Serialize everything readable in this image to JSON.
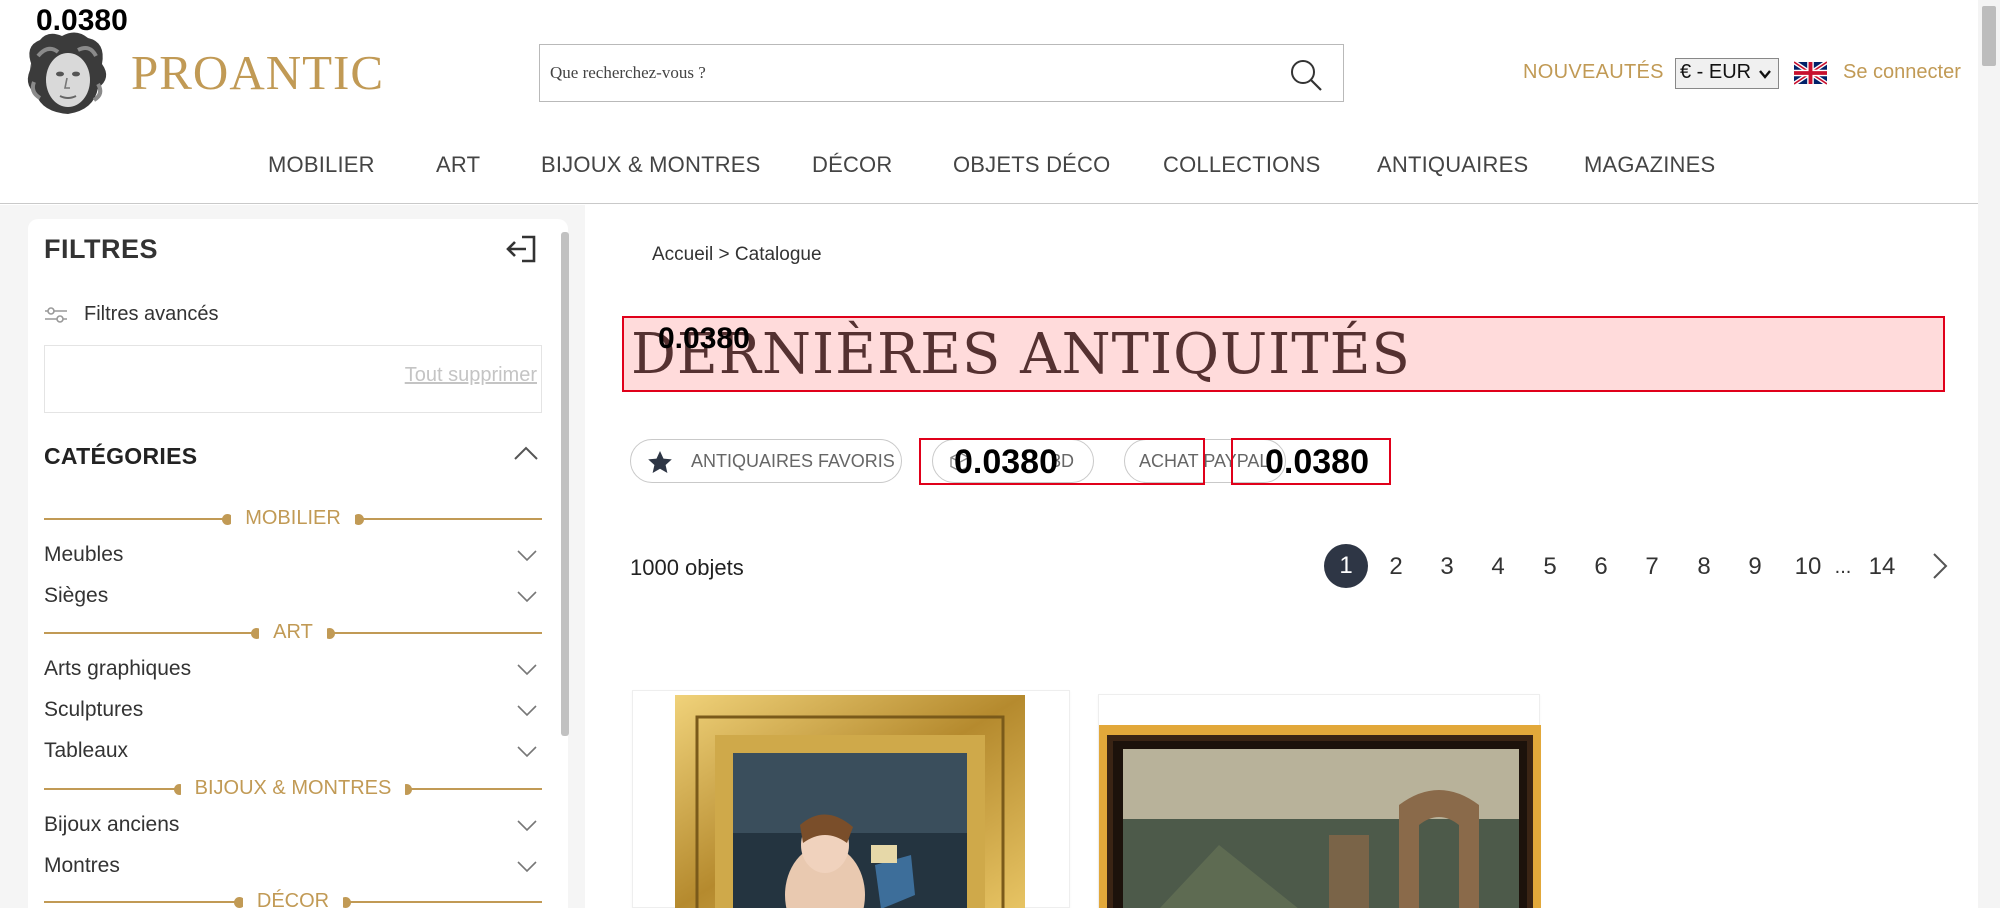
{
  "overlay": {
    "value": "0.0380"
  },
  "brand": {
    "name": "PROANTIC"
  },
  "search": {
    "placeholder": "Que recherchez-vous ?"
  },
  "header": {
    "new_link": "NOUVEAUTÉS",
    "currency": "€ - EUR",
    "language_icon": "uk-flag-icon",
    "login": "Se connecter"
  },
  "nav": {
    "items": [
      {
        "label": "MOBILIER"
      },
      {
        "label": "ART"
      },
      {
        "label": "BIJOUX & MONTRES"
      },
      {
        "label": "DÉCOR"
      },
      {
        "label": "OBJETS DÉCO"
      },
      {
        "label": "COLLECTIONS"
      },
      {
        "label": "ANTIQUAIRES"
      },
      {
        "label": "MAGAZINES"
      }
    ]
  },
  "sidebar": {
    "title": "FILTRES",
    "advanced": "Filtres avancés",
    "clear_all": "Tout supprimer",
    "categories_title": "CATÉGORIES",
    "sections": [
      {
        "label": "MOBILIER",
        "items": [
          "Meubles",
          "Sièges"
        ]
      },
      {
        "label": "ART",
        "items": [
          "Arts graphiques",
          "Sculptures",
          "Tableaux"
        ]
      },
      {
        "label": "BIJOUX & MONTRES",
        "items": [
          "Bijoux anciens",
          "Montres"
        ]
      },
      {
        "label": "DÉCOR",
        "items": []
      }
    ]
  },
  "main": {
    "breadcrumb": "Accueil > Catalogue",
    "title": "DERNIÈRES ANTIQUITÉS",
    "filters": {
      "favorites": "ANTIQUAIRES FAVORIS",
      "third": "3D",
      "paypal": "ACHAT PAYPAL"
    },
    "count": "1000 objets",
    "pagination": {
      "current": "1",
      "pages": [
        "2",
        "3",
        "4",
        "5",
        "6",
        "7",
        "8",
        "9",
        "10"
      ],
      "ellipsis": "...",
      "last": "14"
    }
  },
  "colors": {
    "gold": "#c19a55",
    "dark": "#2e3645",
    "overlay_red": "#e0001a"
  }
}
